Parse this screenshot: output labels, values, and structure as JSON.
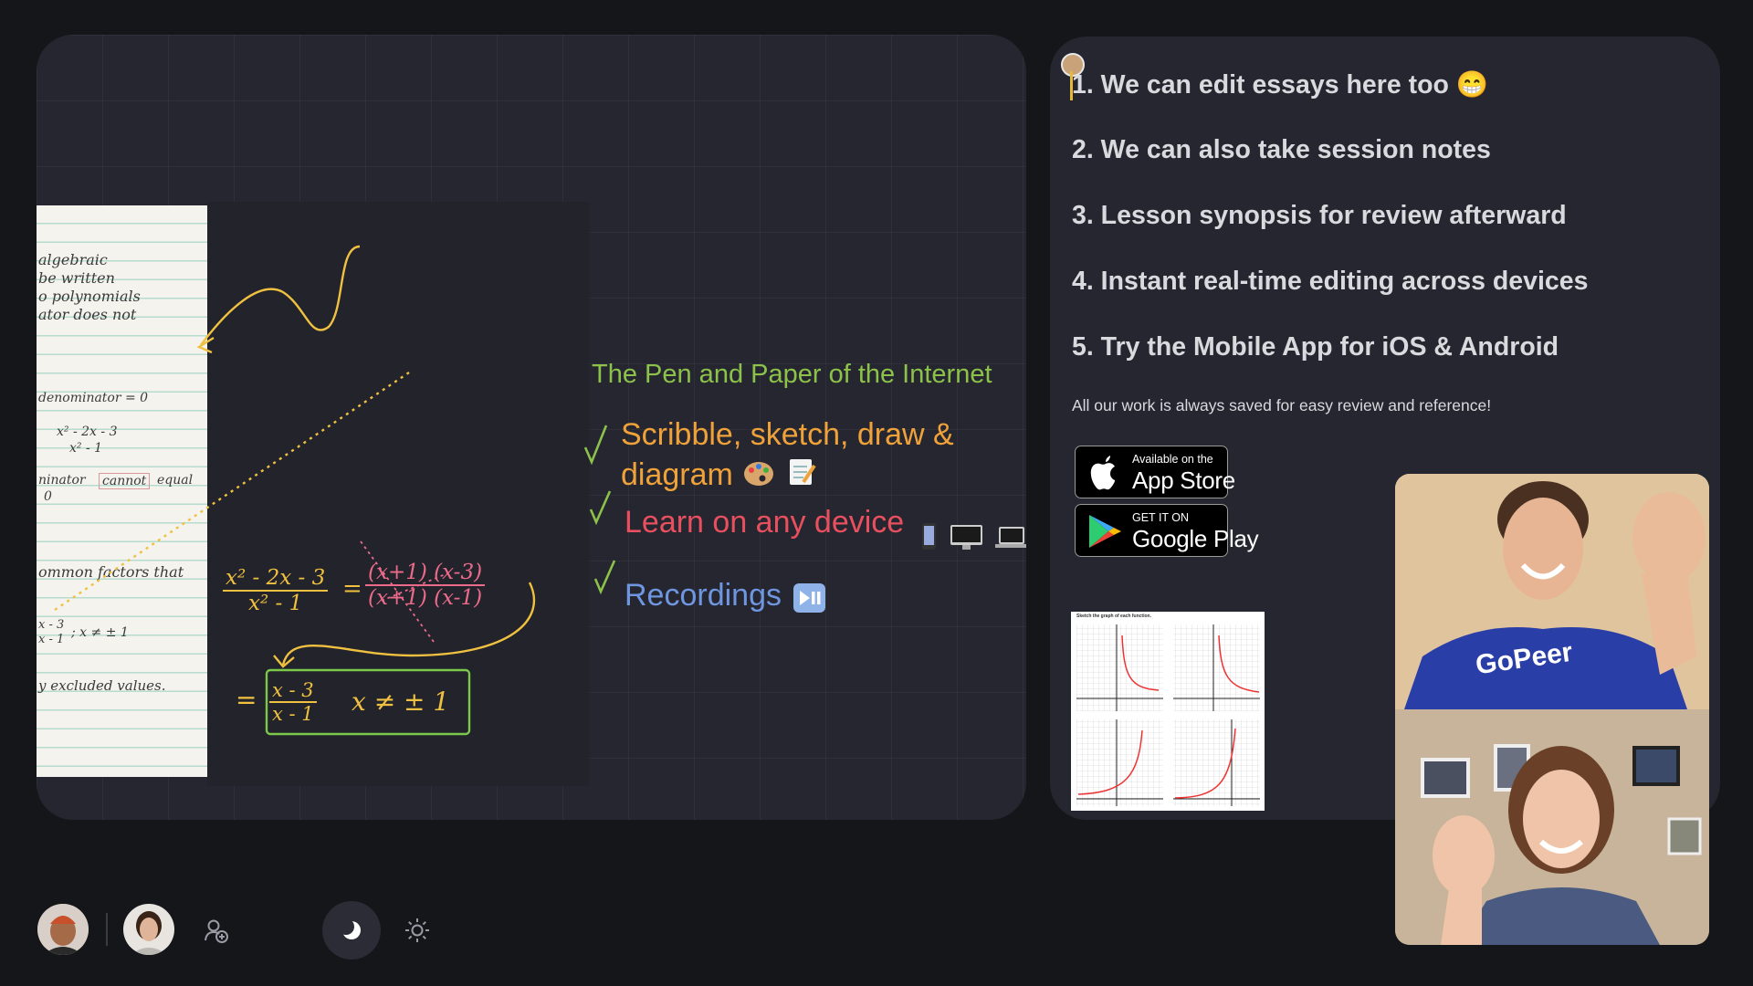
{
  "whiteboard": {
    "title": "The Pen and Paper of the Internet",
    "features": [
      {
        "line1": "Scribble, sketch, draw &",
        "line2": "diagram",
        "color": "#f0a23a"
      },
      {
        "label": "Learn on any device",
        "color": "#e8505f"
      },
      {
        "label": "Recordings",
        "color": "#6f96e0"
      }
    ],
    "check_colors": {
      "1": "#8cc24a",
      "2": "#8cc24a",
      "3": "#8cc24a"
    },
    "icons": {
      "palette": "palette-icon",
      "memo": "memo-icon",
      "phone": "phone-icon",
      "desktop": "desktop-icon",
      "laptop": "laptop-icon",
      "play_pause": "play-pause-icon"
    },
    "paper_notes": [
      "algebraic",
      "be written",
      "o polynomials",
      "ator does not",
      "denominator = 0",
      "x² - 2x - 3",
      "x² - 1",
      "ninator",
      "cannot",
      "equal",
      "0",
      "ommon factors that",
      "x - 3",
      "x - 1",
      "; x ≠ ± 1",
      "y excluded values."
    ],
    "math": {
      "lhs_num": "x² - 2x - 3",
      "lhs_den": "x² - 1",
      "eq1": "=",
      "rhs_num_a": "(x+1)",
      "rhs_num_b": "(x-3)",
      "rhs_den_a": "(x+1)",
      "rhs_den_b": "(x-1)",
      "eq2": "=",
      "ans_num": "x - 3",
      "ans_den": "x - 1",
      "ans_cond": "x ≠ ± 1"
    }
  },
  "notes": {
    "items": [
      "1. We can edit essays here too 😁",
      "2. We can also take session notes",
      "3. Lesson synopsis for review afterward",
      "4. Instant real-time editing across devices",
      "5. Try the Mobile App for iOS & Android"
    ],
    "caption": "All our work is always saved for easy review and reference!",
    "app_store": {
      "small": "Available on the",
      "big": "App Store"
    },
    "google_play": {
      "small": "GET IT ON",
      "big": "Google Play"
    },
    "worksheet_title": "Sketch the graph of each function."
  },
  "video": {
    "shirt_text": "GoPeer"
  },
  "toolbar": {
    "icons": [
      "add-user-icon",
      "moon-icon",
      "sun-icon"
    ]
  },
  "colors": {
    "background": "#15161a",
    "panel": "#25262f",
    "accent_green": "#8cc24a",
    "accent_orange": "#f0a23a",
    "accent_red": "#e8505f",
    "accent_blue": "#6f96e0",
    "marker_yellow": "#f0c040",
    "marker_pink": "#ec6a8a",
    "marker_green": "#7cc84a"
  }
}
